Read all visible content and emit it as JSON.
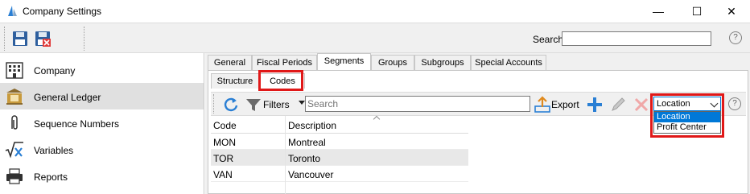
{
  "window": {
    "title": "Company Settings",
    "min_glyph": "—",
    "max_glyph": "☐",
    "close_glyph": "✕"
  },
  "toolbar": {
    "buttons": [
      {
        "name": "save-icon",
        "color": "#2e5f9e"
      },
      {
        "name": "save-close-icon",
        "color": "#2e5f9e"
      }
    ],
    "search_label": "Search",
    "search_value": "",
    "help_glyph": "?"
  },
  "sidebar": {
    "items": [
      {
        "label": "Company",
        "icon": "building-icon",
        "selected": false
      },
      {
        "label": "General Ledger",
        "icon": "ledger-icon",
        "selected": true
      },
      {
        "label": "Sequence Numbers",
        "icon": "paperclip-icon",
        "selected": false
      },
      {
        "label": "Variables",
        "icon": "sqrt-x-icon",
        "selected": false
      },
      {
        "label": "Reports",
        "icon": "printer-icon",
        "selected": false
      }
    ]
  },
  "tabs": [
    "General",
    "Fiscal Periods",
    "Segments",
    "Groups",
    "Subgroups",
    "Special Accounts"
  ],
  "active_tab": "Segments",
  "subtabs": [
    "Structure",
    "Codes"
  ],
  "active_subtab": "Codes",
  "grid_toolbar": {
    "filters_label": "Filters",
    "search_placeholder": "Search",
    "export_label": "Export",
    "segment_select": {
      "value": "Location",
      "options": [
        "Location",
        "Profit Center"
      ],
      "highlighted": "Location"
    },
    "help_glyph": "?"
  },
  "grid": {
    "columns": [
      "Code",
      "Description"
    ],
    "rows": [
      {
        "code": "MON",
        "description": "Montreal"
      },
      {
        "code": "TOR",
        "description": "Toronto"
      },
      {
        "code": "VAN",
        "description": "Vancouver"
      }
    ]
  },
  "colors": {
    "highlight_red": "#e01818",
    "accent_blue": "#0078d7",
    "selected_row": "#e0e0e0"
  }
}
